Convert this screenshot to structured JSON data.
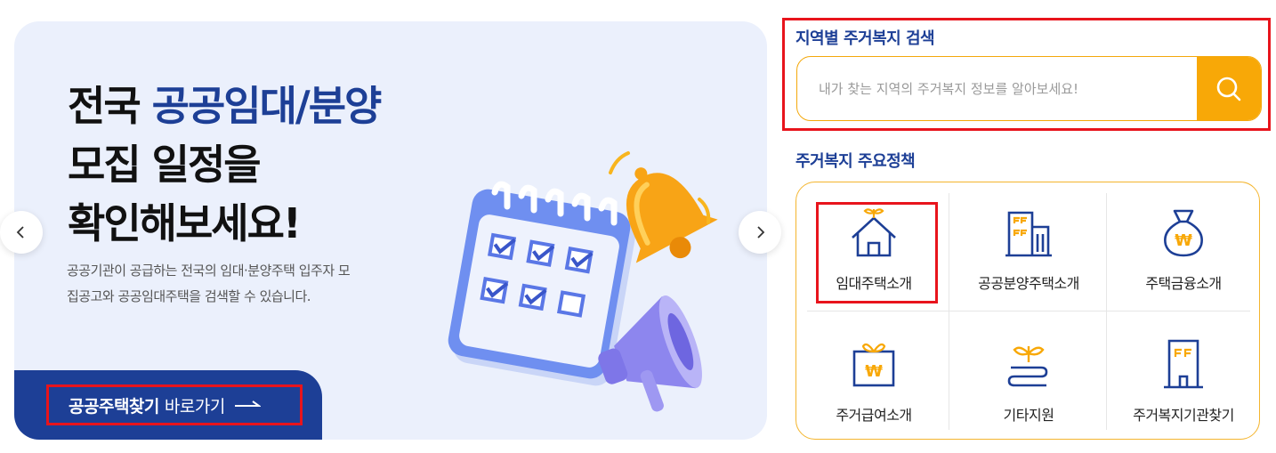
{
  "banner": {
    "headline_1_part_a": "전국 ",
    "headline_1_part_b": "공공임대/분양",
    "headline_2": "모집 일정을",
    "headline_3": "확인해보세요!",
    "description": "공공기관이 공급하는 전국의 임대·분양주택 입주자 모집공고와 공공임대주택을 검색할 수 있습니다.",
    "cta_strong": "공공주택찾기",
    "cta_rest": "바로가기"
  },
  "search": {
    "title": "지역별 주거복지 검색",
    "placeholder": "내가 찾는 지역의 주거복지 정보를 알아보세요!"
  },
  "policies": {
    "title": "주거복지 주요정책",
    "items": [
      {
        "label": "임대주택소개",
        "icon": "house-sprout-icon"
      },
      {
        "label": "공공분양주택소개",
        "icon": "buildings-icon"
      },
      {
        "label": "주택금융소개",
        "icon": "money-bag-won-icon"
      },
      {
        "label": "주거급여소개",
        "icon": "gift-won-icon"
      },
      {
        "label": "기타지원",
        "icon": "sprout-hands-icon"
      },
      {
        "label": "주거복지기관찾기",
        "icon": "office-building-icon"
      }
    ]
  },
  "colors": {
    "navy": "#1d3f96",
    "orange": "#f8a807",
    "highlight_red": "#e8141c",
    "banner_bg": "#ebf0fc"
  }
}
